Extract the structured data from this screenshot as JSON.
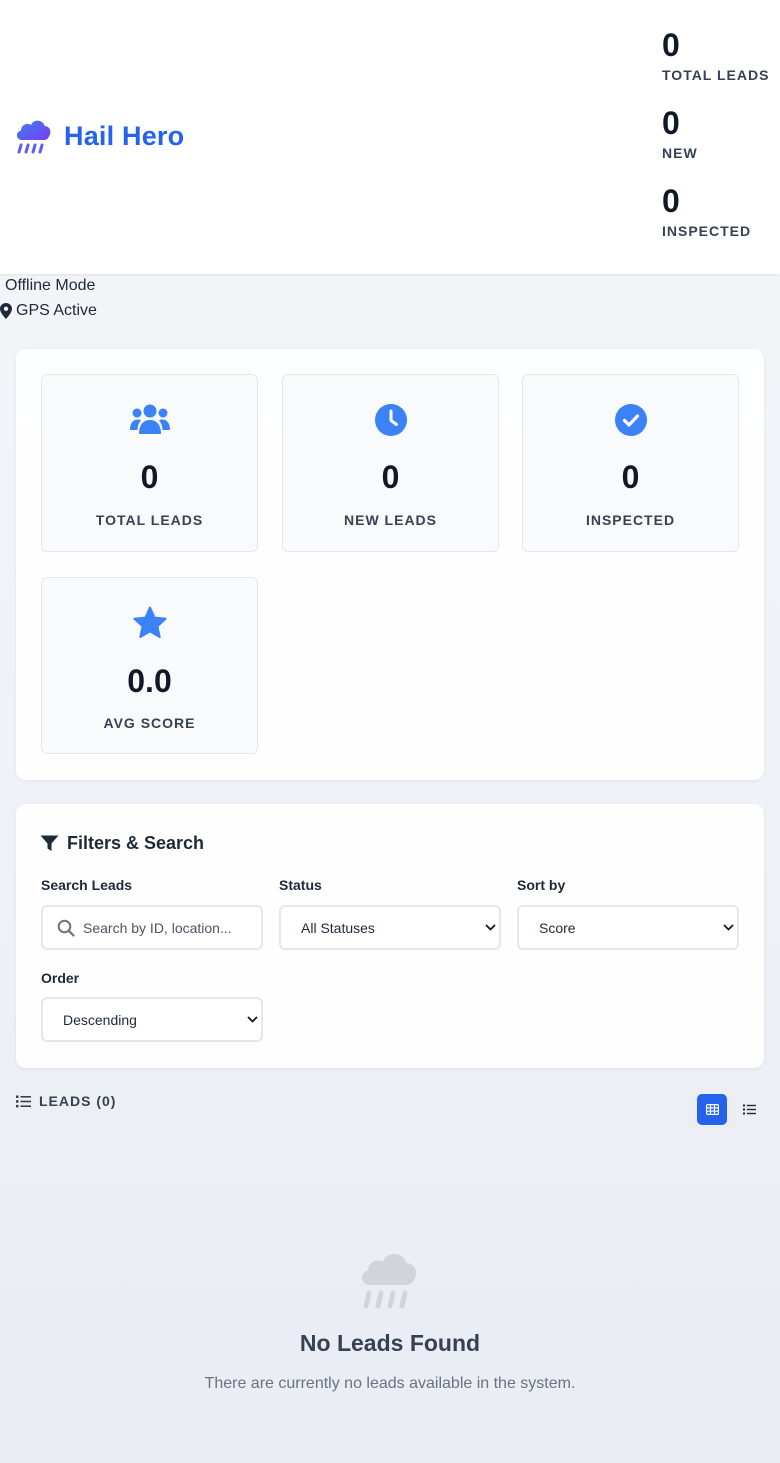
{
  "header": {
    "brand_icon": "cloud-rain-icon",
    "title": "Hail Hero",
    "stats": [
      {
        "value": "0",
        "label": "TOTAL LEADS"
      },
      {
        "value": "0",
        "label": "NEW"
      },
      {
        "value": "0",
        "label": "INSPECTED"
      }
    ]
  },
  "status": {
    "offline": "Offline Mode",
    "gps_icon": "map-pin-icon",
    "gps": "GPS Active"
  },
  "stat_cards": [
    {
      "icon": "users-icon",
      "value": "0",
      "label": "TOTAL LEADS"
    },
    {
      "icon": "clock-icon",
      "value": "0",
      "label": "NEW LEADS"
    },
    {
      "icon": "check-circle-icon",
      "value": "0",
      "label": "INSPECTED"
    },
    {
      "icon": "star-icon",
      "value": "0.0",
      "label": "AVG SCORE"
    }
  ],
  "filters": {
    "title": "Filters & Search",
    "search": {
      "label": "Search Leads",
      "placeholder": "Search by ID, location..."
    },
    "status": {
      "label": "Status",
      "value": "All Statuses"
    },
    "sort": {
      "label": "Sort by",
      "value": "Score"
    },
    "order": {
      "label": "Order",
      "value": "Descending"
    }
  },
  "leads": {
    "title": "LEADS (0)",
    "view_grid_icon": "grid-icon",
    "view_list_icon": "list-icon"
  },
  "empty": {
    "icon": "cloud-rain-icon",
    "title": "No Leads Found",
    "text": "There are currently no leads available in the system."
  },
  "colors": {
    "accent": "#2563eb",
    "icon_blue": "#3b82f6",
    "brand_gradient_start": "#3b82f6",
    "brand_gradient_end": "#7c3aed"
  }
}
